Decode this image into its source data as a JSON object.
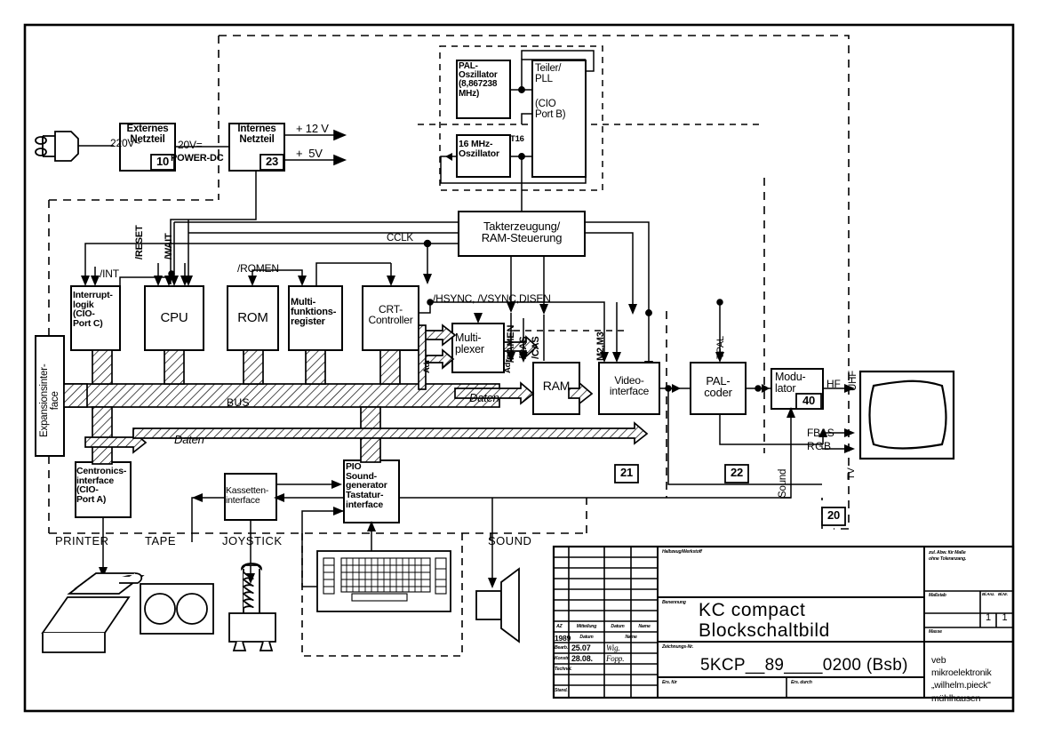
{
  "diagram": {
    "title_main": "KC compact",
    "title_sub": "Blockschaltbild",
    "drawing_no": "5KCP__89____0200 (Bsb)"
  },
  "power": {
    "mains_label": "220V~",
    "external_psu": "Externes\nNetzteil",
    "external_psu_no": "10",
    "dc_label": "20V=",
    "power_dc": "POWER-DC",
    "internal_psu": "Internes\nNetzteil",
    "internal_psu_no": "23",
    "rail_12v": "+ 12 V",
    "rail_5v": "+  5V"
  },
  "clock": {
    "pal_osc": "PAL-\nOszillator\n(8,867238\nMHz)",
    "teiler": "Teiler/\nPLL",
    "cio_port_b": "(CIO\nPort B)",
    "osc16": "16 MHz-\nOszillator",
    "t16": "T16",
    "takterzeugung": "Takterzeugung/\nRAM-Steuerung",
    "cclk": "CCLK"
  },
  "blocks": {
    "interrupt": "Interrupt-\nlogik\n(CIO-\nPort C)",
    "cpu": "CPU",
    "rom": "ROM",
    "mfr": "Multi-\nfunktions-\nregister",
    "crtc": "CRT-\nController",
    "multiplexer": "Multi-\nplexer",
    "ram": "RAM",
    "video_if": "Video-\ninterface",
    "pal_coder": "PAL-\ncoder",
    "modulator": "Modu-\nlator",
    "modulator_no": "40",
    "expansion": "Expansionsinter-\nface",
    "centronics": "Centronics-\ninterface\n(CIO-\nPort A)",
    "kassetten": "Kassetten-\ninterface",
    "pio": "PIO\nSound-\ngenerator\nTastatur-\ninterface"
  },
  "signals": {
    "int": "/INT",
    "reset": "/RESET",
    "wait": "/WAIT",
    "romen": "/ROMEN",
    "sync": "/HSYNC, /VSYNC,DISEN",
    "adr1": "Adr",
    "adr2": "Adr",
    "ramen": "/RAMEN",
    "ras": "/RAS",
    "cas": "/CAS",
    "m2m3": "M2,M3",
    "tpal": "TPAL",
    "daten1": "Daten",
    "daten2": "Daten",
    "bus": "BUS",
    "hf": "HF",
    "uhf": "UHF",
    "fbas": "FBAS",
    "rgb": "RGB",
    "tv": "TV",
    "sound": "Sound"
  },
  "callouts": {
    "c20": "20",
    "c21": "21",
    "c22": "22"
  },
  "peripherals": {
    "printer": "PRINTER",
    "tape": "TAPE",
    "joystick": "JOYSTICK",
    "sound": "SOUND"
  },
  "titleblock": {
    "col_az": "AZ",
    "col_mitteilung": "Mitteilung",
    "col_datum": "Datum",
    "col_name": "Name",
    "year": "1989",
    "row_bearb": "Bearb.",
    "row_konstr": "Konstr.",
    "row_technol": "Technol.",
    "row_stand": "Stand.",
    "datum_head": "Datum",
    "name_head": "Name",
    "bearb_date": "25.07",
    "konstr_date": "28.08.",
    "bearb_name": "Wig.",
    "konstr_name": "Fopp.",
    "halbzeug": "Halbzeug/Werkstoff",
    "benennung": "Benennung",
    "zeichnungs_nr": "Zeichnungs-Nr.",
    "ers_fuer": "Ers. für",
    "ers_durch": "Ers. durch",
    "zul_abw": "zul. Abw. für Maße\nohne Toleranzang.",
    "massstab": "Maßstab",
    "bl_anz": "Bl.Anz.",
    "bl_nr": "Bl.Nr.",
    "bl_anz_val": "1",
    "bl_nr_val": "1",
    "masse": "Masse",
    "company": "veb\nmikroelektronik\n„wilhelm.pieck\"\nmühlhausen"
  }
}
